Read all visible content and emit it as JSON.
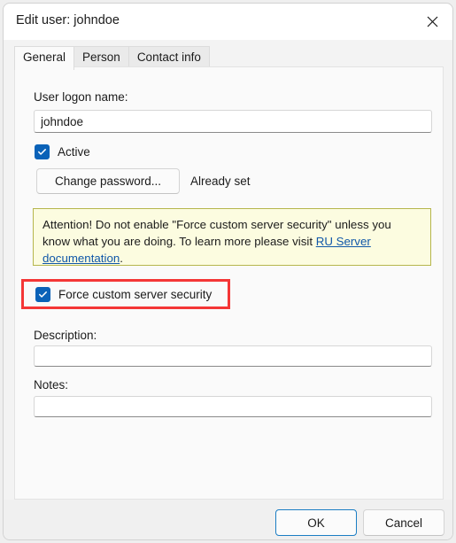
{
  "window": {
    "title": "Edit user: johndoe",
    "close_icon": "close-icon"
  },
  "tabs": [
    {
      "label": "General",
      "active": true
    },
    {
      "label": "Person",
      "active": false
    },
    {
      "label": "Contact info",
      "active": false
    }
  ],
  "form": {
    "logon_name": {
      "label": "User logon name:",
      "value": "johndoe",
      "placeholder": ""
    },
    "active_checkbox": {
      "label": "Active",
      "checked": true
    },
    "change_password_button": "Change password...",
    "password_status": "Already set",
    "warning": {
      "text_before": "Attention! Do not enable \"Force custom server security\" unless you know what you are doing. To learn more please visit ",
      "link_text": "RU Server documentation",
      "text_after": ".",
      "bg_color": "#fcfce0",
      "border_color": "#b6b64d",
      "link_color": "#1057a8"
    },
    "force_security_checkbox": {
      "label": "Force custom server security",
      "checked": true,
      "highlight_color": "#f43636"
    },
    "description": {
      "label": "Description:",
      "value": "",
      "placeholder": ""
    },
    "notes": {
      "label": "Notes:",
      "value": "",
      "placeholder": ""
    }
  },
  "footer": {
    "ok_label": "OK",
    "cancel_label": "Cancel",
    "accent_color": "#1b7ec4"
  },
  "theme": {
    "checkbox_accent": "#0a62b8",
    "window_bg": "#f3f3f3",
    "panel_bg": "#fafafa"
  }
}
